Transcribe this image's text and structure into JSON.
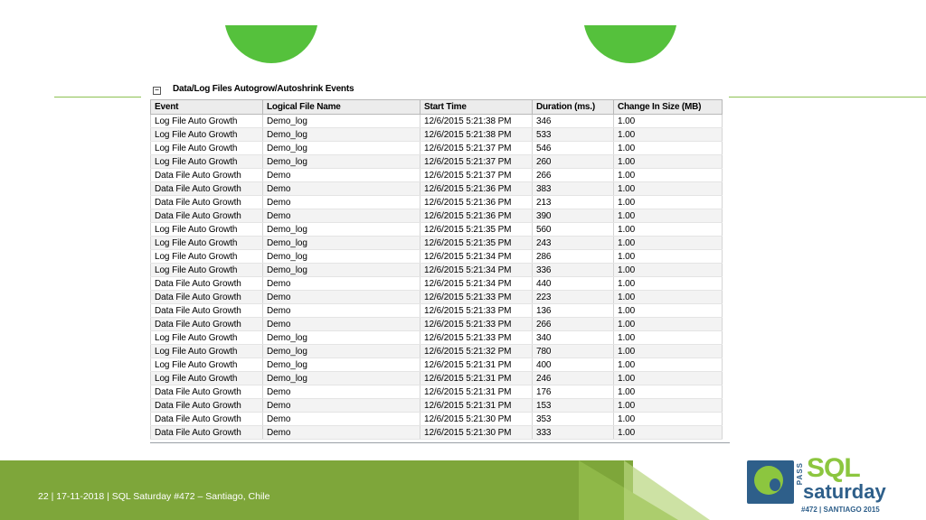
{
  "report": {
    "collapse_glyph": "−",
    "section_title": "Data/Log Files Autogrow/Autoshrink Events",
    "columns": [
      "Event",
      "Logical File Name",
      "Start Time",
      "Duration (ms.)",
      "Change In Size (MB)"
    ],
    "rows": [
      [
        "Log File Auto Growth",
        "Demo_log",
        "12/6/2015 5:21:38 PM",
        "346",
        "1.00"
      ],
      [
        "Log File Auto Growth",
        "Demo_log",
        "12/6/2015 5:21:38 PM",
        "533",
        "1.00"
      ],
      [
        "Log File Auto Growth",
        "Demo_log",
        "12/6/2015 5:21:37 PM",
        "546",
        "1.00"
      ],
      [
        "Log File Auto Growth",
        "Demo_log",
        "12/6/2015 5:21:37 PM",
        "260",
        "1.00"
      ],
      [
        "Data File Auto Growth",
        "Demo",
        "12/6/2015 5:21:37 PM",
        "266",
        "1.00"
      ],
      [
        "Data File Auto Growth",
        "Demo",
        "12/6/2015 5:21:36 PM",
        "383",
        "1.00"
      ],
      [
        "Data File Auto Growth",
        "Demo",
        "12/6/2015 5:21:36 PM",
        "213",
        "1.00"
      ],
      [
        "Data File Auto Growth",
        "Demo",
        "12/6/2015 5:21:36 PM",
        "390",
        "1.00"
      ],
      [
        "Log File Auto Growth",
        "Demo_log",
        "12/6/2015 5:21:35 PM",
        "560",
        "1.00"
      ],
      [
        "Log File Auto Growth",
        "Demo_log",
        "12/6/2015 5:21:35 PM",
        "243",
        "1.00"
      ],
      [
        "Log File Auto Growth",
        "Demo_log",
        "12/6/2015 5:21:34 PM",
        "286",
        "1.00"
      ],
      [
        "Log File Auto Growth",
        "Demo_log",
        "12/6/2015 5:21:34 PM",
        "336",
        "1.00"
      ],
      [
        "Data File Auto Growth",
        "Demo",
        "12/6/2015 5:21:34 PM",
        "440",
        "1.00"
      ],
      [
        "Data File Auto Growth",
        "Demo",
        "12/6/2015 5:21:33 PM",
        "223",
        "1.00"
      ],
      [
        "Data File Auto Growth",
        "Demo",
        "12/6/2015 5:21:33 PM",
        "136",
        "1.00"
      ],
      [
        "Data File Auto Growth",
        "Demo",
        "12/6/2015 5:21:33 PM",
        "266",
        "1.00"
      ],
      [
        "Log File Auto Growth",
        "Demo_log",
        "12/6/2015 5:21:33 PM",
        "340",
        "1.00"
      ],
      [
        "Log File Auto Growth",
        "Demo_log",
        "12/6/2015 5:21:32 PM",
        "780",
        "1.00"
      ],
      [
        "Log File Auto Growth",
        "Demo_log",
        "12/6/2015 5:21:31 PM",
        "400",
        "1.00"
      ],
      [
        "Log File Auto Growth",
        "Demo_log",
        "12/6/2015 5:21:31 PM",
        "246",
        "1.00"
      ],
      [
        "Data File Auto Growth",
        "Demo",
        "12/6/2015 5:21:31 PM",
        "176",
        "1.00"
      ],
      [
        "Data File Auto Growth",
        "Demo",
        "12/6/2015 5:21:31 PM",
        "153",
        "1.00"
      ],
      [
        "Data File Auto Growth",
        "Demo",
        "12/6/2015 5:21:30 PM",
        "353",
        "1.00"
      ],
      [
        "Data File Auto Growth",
        "Demo",
        "12/6/2015 5:21:30 PM",
        "333",
        "1.00"
      ]
    ]
  },
  "footer": {
    "text": "22  |  17-11-2018 |    SQL Saturday #472 – Santiago, Chile"
  },
  "logo": {
    "pass": "PASS",
    "sql": "SQL",
    "saturday": "saturday",
    "subtitle": "#472 | SANTIAGO 2015"
  },
  "colors": {
    "accent_green": "#55c13c",
    "footer_green": "#7ea63a",
    "logo_blue": "#2e5f8a"
  }
}
